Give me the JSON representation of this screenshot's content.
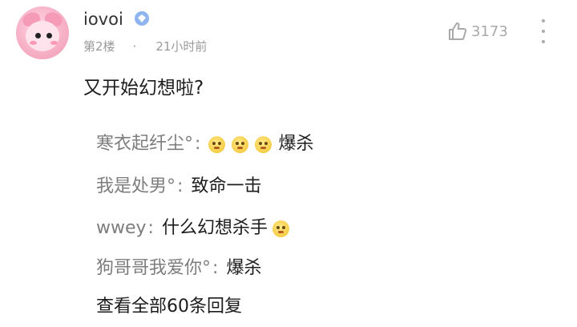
{
  "comment": {
    "username": "iovoi",
    "floor": "第2楼",
    "separator": "·",
    "time": "21小时前",
    "like_count": "3173",
    "content": "又开始幻想啦?"
  },
  "replies": [
    {
      "name": "寒衣起纤尘°",
      "sep": ":",
      "emojis": 3,
      "text": "爆杀"
    },
    {
      "name": "我是处男°",
      "sep": ":",
      "emojis": 0,
      "text": "致命一击"
    },
    {
      "name": "wwey",
      "sep": ":",
      "emojis": 0,
      "text": "什么幻想杀手",
      "trailing_emoji": true
    },
    {
      "name": "狗哥哥我爱你°",
      "sep": ":",
      "emojis": 0,
      "text": "爆杀"
    }
  ],
  "view_all": "查看全部60条回复",
  "colors": {
    "name_gray": "#7d7d7d",
    "meta_gray": "#9a9a9a",
    "badge_blue": "#8fb4ee"
  },
  "icons": {
    "like": "thumbs-up-icon",
    "more": "more-vertical-icon",
    "badge": "verified-badge-icon",
    "emoji": "face-emoji-icon"
  }
}
